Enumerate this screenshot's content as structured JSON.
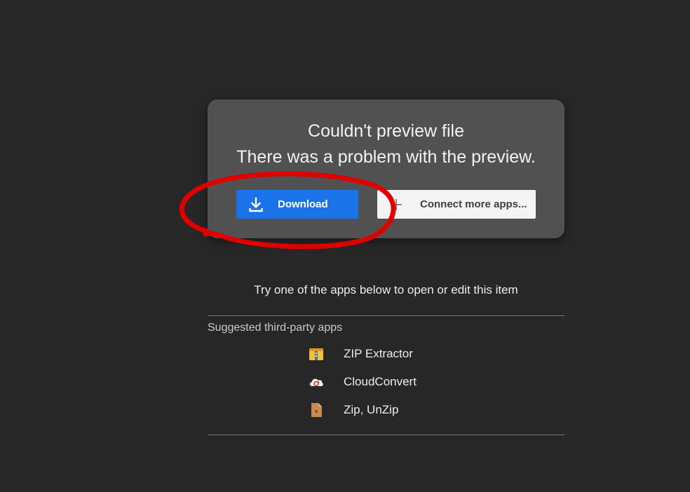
{
  "error_card": {
    "title": "Couldn't preview file",
    "subtitle": "There was a problem with the preview.",
    "download_button": {
      "label": "Download",
      "icon": "download-icon",
      "color": "#1a73e8"
    },
    "connect_button": {
      "label": "Connect more apps...",
      "icon": "plus-icon"
    }
  },
  "annotation": {
    "shape": "hand-drawn-ellipse",
    "color": "#e00000",
    "target": "download_button"
  },
  "apps_section": {
    "prompt": "Try one of the apps below to open or edit this item",
    "heading": "Suggested third-party apps",
    "apps": [
      {
        "name": "ZIP Extractor",
        "icon": "zip-extractor-icon"
      },
      {
        "name": "CloudConvert",
        "icon": "cloudconvert-icon"
      },
      {
        "name": "Zip, UnZip",
        "icon": "zip-unzip-icon"
      }
    ]
  }
}
